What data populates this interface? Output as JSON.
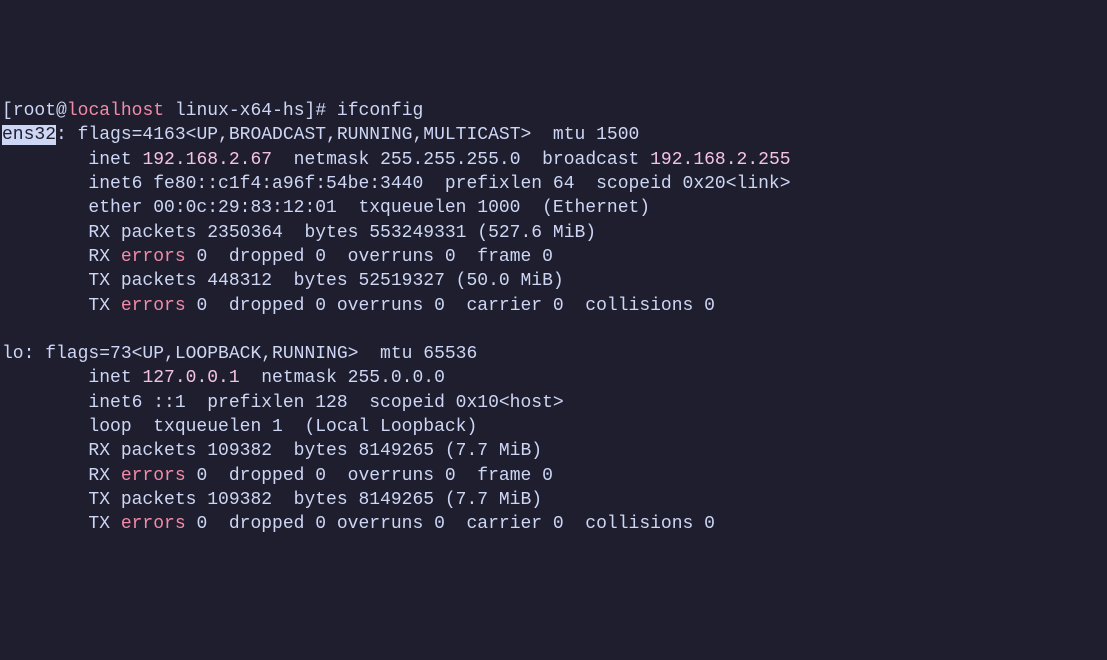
{
  "prompt": {
    "user": "root",
    "at": "@",
    "host": "localhost",
    "path": "linux-x64-hs",
    "command": "ifconfig"
  },
  "iface1": {
    "name": "ens32",
    "flags_line": ": flags=4163<UP,BROADCAST,RUNNING,MULTICAST>  mtu 1500",
    "inet_prefix": "        inet ",
    "inet_addr": "192.168.2.67",
    "inet_mid": "  netmask 255.255.255.0  broadcast ",
    "inet_bcast": "192.168.2.255",
    "inet6": "        inet6 fe80::c1f4:a96f:54be:3440  prefixlen 64  scopeid 0x20<link>",
    "ether": "        ether 00:0c:29:83:12:01  txqueuelen 1000  (Ethernet)",
    "rx_packets": "        RX packets 2350364  bytes 553249331 (527.6 MiB)",
    "rx_err_pre": "        RX ",
    "rx_err_word": "errors",
    "rx_err_post": " 0  dropped 0  overruns 0  frame 0",
    "tx_packets": "        TX packets 448312  bytes 52519327 (50.0 MiB)",
    "tx_err_pre": "        TX ",
    "tx_err_word": "errors",
    "tx_err_post": " 0  dropped 0 overruns 0  carrier 0  collisions 0"
  },
  "iface2": {
    "header": "lo: flags=73<UP,LOOPBACK,RUNNING>  mtu 65536",
    "inet_prefix": "        inet ",
    "inet_addr": "127.0.0.1",
    "inet_post": "  netmask 255.0.0.0",
    "inet6": "        inet6 ::1  prefixlen 128  scopeid 0x10<host>",
    "loop": "        loop  txqueuelen 1  (Local Loopback)",
    "rx_packets": "        RX packets 109382  bytes 8149265 (7.7 MiB)",
    "rx_err_pre": "        RX ",
    "rx_err_word": "errors",
    "rx_err_post": " 0  dropped 0  overruns 0  frame 0",
    "tx_packets": "        TX packets 109382  bytes 8149265 (7.7 MiB)",
    "tx_err_pre": "        TX ",
    "tx_err_word": "errors",
    "tx_err_post": " 0  dropped 0 overruns 0  carrier 0  collisions 0"
  }
}
